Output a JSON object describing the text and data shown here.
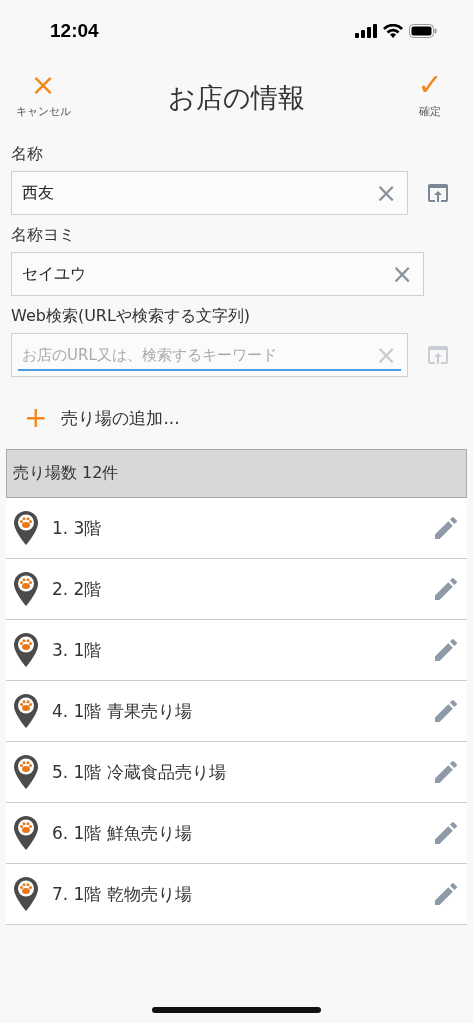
{
  "status_bar": {
    "time": "12:04"
  },
  "header": {
    "title": "お店の情報",
    "cancel": {
      "label": "キャンセル",
      "icon": "×"
    },
    "confirm": {
      "label": "確定",
      "icon": "✓"
    }
  },
  "fields": [
    {
      "label": "名称",
      "value": "西友",
      "clear": "×",
      "focused": false,
      "upload": {
        "disabled": false
      }
    },
    {
      "label": "名称ヨミ",
      "value": "セイユウ",
      "clear": "×",
      "focused": false
    },
    {
      "label": "Web検索(URLや検索する文字列)",
      "placeholder": "お店のURL又は、検索するキーワード",
      "clear": "×",
      "focused": true,
      "upload": {
        "disabled": true
      }
    }
  ],
  "add_button": {
    "icon": "+",
    "label": "売り場の追加..."
  },
  "list_header": "売り場数 12件",
  "floors": [
    {
      "label": "1. 3階"
    },
    {
      "label": "2. 2階"
    },
    {
      "label": "3. 1階"
    },
    {
      "label": "4. 1階 青果売り場"
    },
    {
      "label": "5. 1階 冷蔵食品売り場"
    },
    {
      "label": "6. 1階 鮮魚売り場"
    },
    {
      "label": "7. 1階 乾物売り場"
    }
  ]
}
